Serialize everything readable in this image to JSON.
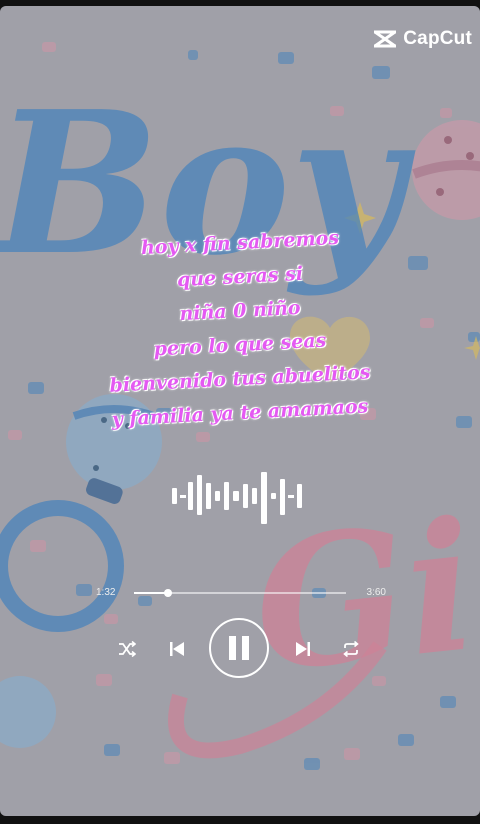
{
  "app": {
    "watermark": "CapCut"
  },
  "lyrics": [
    "hoy x fin sabremos",
    "que seras si",
    "niña  0  niño",
    "pero lo que seas",
    "bienvenido  tus abuelitos",
    "y familia  ya  te amamaos"
  ],
  "player": {
    "current_time": "1:32",
    "total_time": "3:60",
    "progress_fraction": 0.16,
    "state": "playing"
  },
  "background": {
    "text_blue": "Boy",
    "text_pink": "Girl"
  },
  "icons": {
    "logo": "capcut-logo-icon",
    "waveform": "audio-waveform-icon",
    "shuffle": "shuffle-icon",
    "previous": "skip-previous-icon",
    "pause": "pause-icon",
    "next": "skip-next-icon",
    "repeat": "repeat-icon"
  },
  "colors": {
    "lyric": "#e45af2",
    "blue_art": "#3f86c9",
    "pink_art": "#e0849c",
    "background": "#a9a9b1"
  }
}
